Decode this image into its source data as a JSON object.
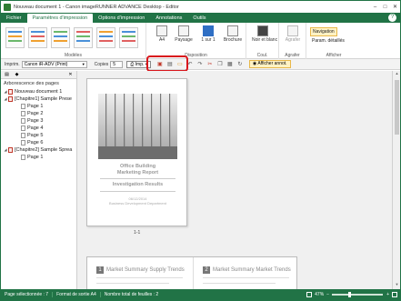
{
  "window": {
    "title": "Nouveau document 1 - Canon imageRUNNER ADVANCE Desktop - Editor",
    "controls": [
      "–",
      "□",
      "✕"
    ]
  },
  "menu": {
    "tabs": [
      "Fichier",
      "Paramètres d'impression",
      "Options d'impression",
      "Annotations",
      "Outils"
    ],
    "help": "?"
  },
  "ribbon": {
    "groups": {
      "modeles": "Modèles",
      "disposition": "Disposition",
      "coul": "Coul.",
      "agrafer": "Agrafer",
      "afficher": "Afficher"
    },
    "buttons": {
      "format": "A4",
      "orientation": "Paysage",
      "copies_label": "1 sur 1",
      "brochure": "Brochure",
      "couleur": "Noir et blanc",
      "agrafer": "Agrafer"
    },
    "nav": {
      "navigation": "Navigation",
      "params": "Param. détaillés"
    }
  },
  "toolbar": {
    "printer_label": "Imprim.",
    "printer_value": "Canon iR-ADV (Print)",
    "copies_label": "Copies",
    "copies_value": "5",
    "print_button": "Imp.",
    "afficher_annot": "Afficher annot."
  },
  "pane": {
    "title": "Arborescence des pages",
    "tree": [
      {
        "label": "Nouveau document 1",
        "level": 0,
        "red": true
      },
      {
        "label": "[Chapitre1] Sample Prese",
        "level": 1,
        "red": true
      },
      {
        "label": "Page 1",
        "level": 2
      },
      {
        "label": "Page 2",
        "level": 2
      },
      {
        "label": "Page 3",
        "level": 2
      },
      {
        "label": "Page 4",
        "level": 2
      },
      {
        "label": "Page 5",
        "level": 2
      },
      {
        "label": "Page 6",
        "level": 2
      },
      {
        "label": "[Chapitre2] Sample Sprea",
        "level": 1,
        "red": true
      },
      {
        "label": "Page 1",
        "level": 2
      }
    ]
  },
  "preview": {
    "page1": {
      "title_line1": "Office Building",
      "title_line2": "Marketing Report",
      "subtitle": "Investigation Results",
      "date": "06/12/2014",
      "dept": "Business Development Department",
      "label": "1-1"
    },
    "page2": {
      "left_num": "1",
      "left_head": "Market Summary  Supply Trends",
      "right_num": "2",
      "right_head": "Market Summary  Market Trends"
    }
  },
  "status": {
    "selected": "Page sélectionnée : 7",
    "format": "Format de sortie A4",
    "total": "Nombre total de feuilles : 2",
    "zoom": "47%",
    "zoom_level": 0.47
  },
  "colors": {
    "accent": "#217346",
    "highlight": "#d9161c"
  }
}
